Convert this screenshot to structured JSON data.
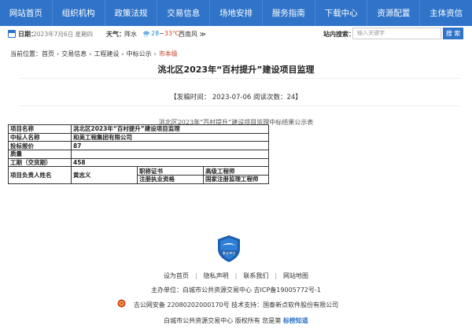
{
  "nav": {
    "items": [
      "网站首页",
      "组织机构",
      "政策法规",
      "交易信息",
      "场地安排",
      "服务指南",
      "下载中心",
      "资源配置",
      "主体资信"
    ]
  },
  "info": {
    "date_label": "日期：",
    "date_value": "2023年7月6日 星期四",
    "weather_label": "天气：",
    "weather_condition": "阵水",
    "temp_low": "28",
    "temp_high": "33℃",
    "temp_sep": "~",
    "wind": "西南风 ≫"
  },
  "search": {
    "label": "站内搜索：",
    "placeholder": "输入关键字",
    "button": "搜 索"
  },
  "breadcrumb": {
    "prefix": "当前位置：",
    "items": [
      "首页",
      "交易信息",
      "工程建设",
      "中标公示"
    ],
    "current": "市本级",
    "sep": "›"
  },
  "article": {
    "title": "洮北区2023年“百村提升”建设项目监理",
    "meta": "【发稿时间： 2023-07-06   阅读次数：24】",
    "caption": "洮北区2023年“百村提升”建设项目监理中标结果公示表"
  },
  "table": {
    "project_name_label": "项目名称",
    "project_name": "洮北区2023年“百村提升”建设项目监理",
    "winner_label": "中标人名称",
    "winner": "和美工程集团有限公司",
    "bid_label": "投标报价",
    "bid": "87",
    "quality_label": "质量",
    "quality": "",
    "period_label": "工期（交货期）",
    "period": "458",
    "manager_label": "项目负责人姓名",
    "manager": "黄志义",
    "cert_label": "职称证书",
    "cert_value": "高级工程师",
    "license_label": "注册执业资格",
    "license_value": "国家注册监理工程师"
  },
  "footer": {
    "logo_text": "事业单位",
    "links": [
      "设为首页",
      "隐私声明",
      "联系我们",
      "网站地图"
    ],
    "line1": "主办单位：白城市公共资源交易中心  吉ICP备19005772号-1",
    "line2": "吉公网安备 22080202000170号  技术支持：国泰新点软件股份有限公司",
    "line3": "白城市公共资源交易中心 版权所有  您是第",
    "accessible": "标榜知道"
  },
  "colors": {
    "nav_bg": "#2f74c9",
    "breadcrumb_current": "#c8402a"
  }
}
